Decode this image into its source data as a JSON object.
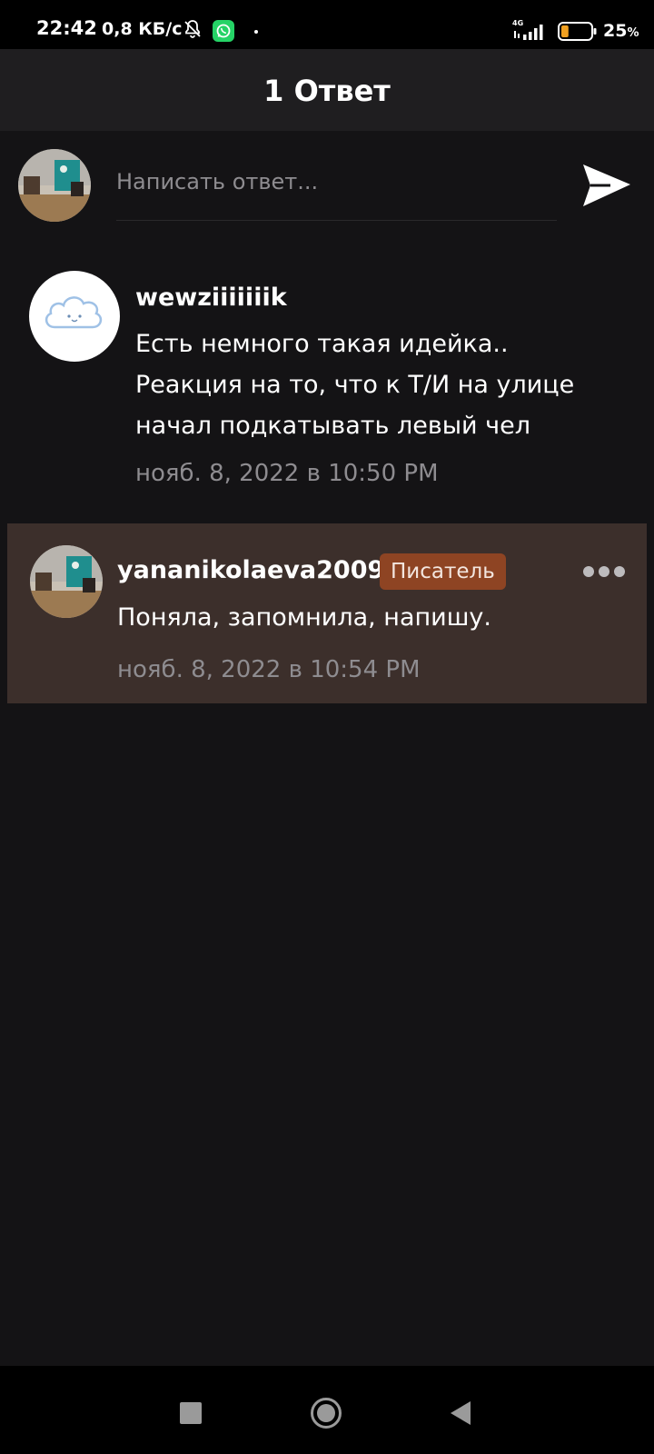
{
  "status_bar": {
    "time": "22:42",
    "network_speed": "0,8 КБ/с",
    "network_type": "4G",
    "battery_percent": "25",
    "battery_unit": "%",
    "battery_level": 0.25,
    "icons": [
      "bell-off-icon",
      "whatsapp-icon",
      "signal-icon",
      "battery-icon"
    ]
  },
  "header": {
    "title": "1 Ответ"
  },
  "composer": {
    "placeholder": "Написать ответ...",
    "send_icon": "send-icon"
  },
  "parent_comment": {
    "username": "wewziiiiiiik",
    "lines": [
      "Есть немного такая идейка..",
      "Реакция на то, что к Т/И на улице",
      "начал подкатывать левый чел"
    ],
    "timestamp": "нояб. 8, 2022 в 10:50 PM"
  },
  "reply": {
    "username": "yananikolaeva2009",
    "badge": "Писатель",
    "text": "Поняла, запомнила, напишу.",
    "timestamp": "нояб. 8, 2022 в 10:54 PM",
    "more_icon": "more-dots-icon"
  },
  "colors": {
    "background": "#141315",
    "header": "#1f1e20",
    "reply_card": "#3c2f2b",
    "badge": "#8e4423",
    "muted_text": "#8e8c90"
  }
}
